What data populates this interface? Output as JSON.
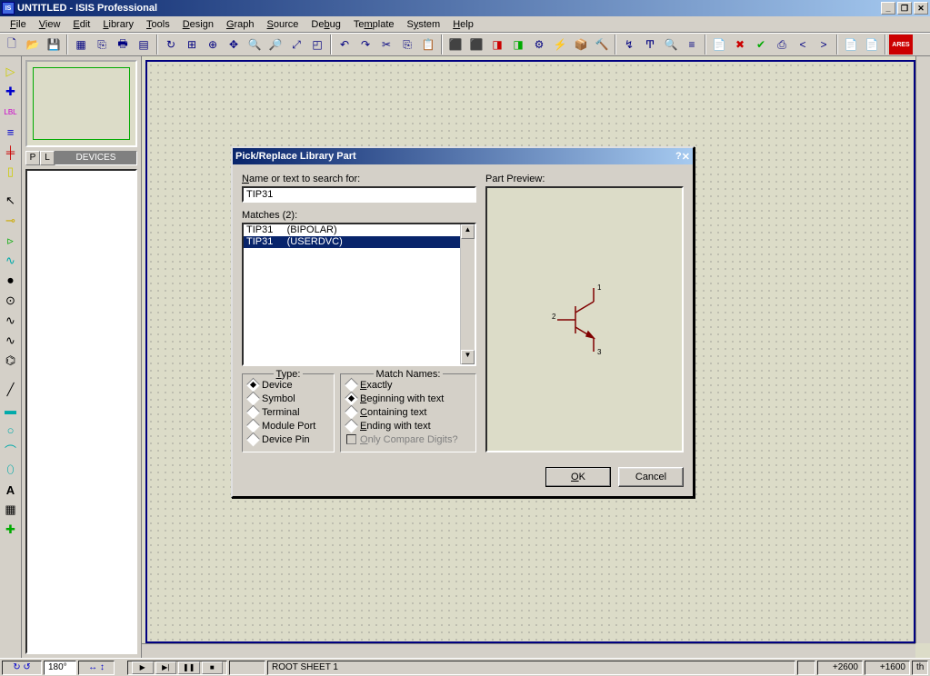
{
  "title": "UNTITLED - ISIS Professional",
  "menus": [
    "File",
    "View",
    "Edit",
    "Library",
    "Tools",
    "Design",
    "Graph",
    "Source",
    "Debug",
    "Template",
    "System",
    "Help"
  ],
  "sidepanel": {
    "p": "P",
    "l": "L",
    "devices_label": "DEVICES"
  },
  "dialog": {
    "title": "Pick/Replace Library Part",
    "search_label": "Name or text to search for:",
    "search_value": "TIP31",
    "matches_label": "Matches (2):",
    "matches": [
      {
        "text": "TIP31     (BIPOLAR)",
        "selected": false
      },
      {
        "text": "TIP31     (USERDVC)",
        "selected": true
      }
    ],
    "type_caption": "Type:",
    "type_options": [
      "Device",
      "Symbol",
      "Terminal",
      "Module Port",
      "Device Pin"
    ],
    "type_selected": "Device",
    "match_caption": "Match Names:",
    "match_options": [
      "Exactly",
      "Beginning with text",
      "Containing text",
      "Ending with text"
    ],
    "match_selected": "Beginning with text",
    "only_digits": "Only Compare Digits?",
    "preview_label": "Part Preview:",
    "preview_pins": [
      "1",
      "2",
      "3"
    ],
    "ok": "OK",
    "cancel": "Cancel"
  },
  "statusbar": {
    "angle": "180°",
    "sheet": "ROOT SHEET 1",
    "coord_x": "+2600",
    "coord_y": "+1600",
    "unit": "th"
  }
}
